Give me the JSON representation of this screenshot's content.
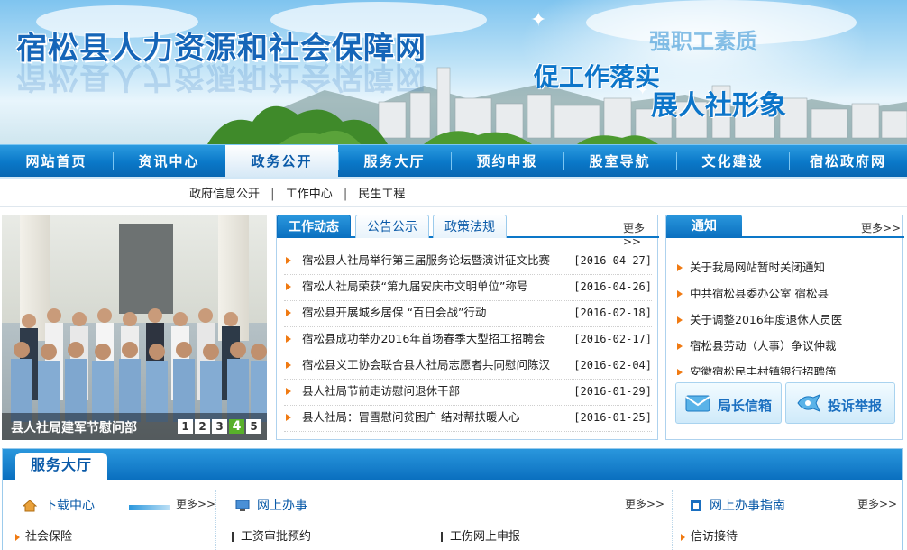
{
  "header": {
    "site_title": "宿松县人力资源和社会保障网",
    "slogan_top": "强职工素质",
    "slogan_1": "促工作落实",
    "slogan_2": "展人社形象"
  },
  "nav": {
    "items": [
      "网站首页",
      "资讯中心",
      "政务公开",
      "服务大厅",
      "预约申报",
      "股室导航",
      "文化建设",
      "宿松政府网"
    ],
    "active_index": 2
  },
  "subnav": {
    "items": [
      "政府信息公开",
      "工作中心",
      "民生工程"
    ],
    "separator": "|"
  },
  "slider": {
    "caption": "县人社局建军节慰问部",
    "pages": [
      "1",
      "2",
      "3",
      "4",
      "5"
    ],
    "active_page": "4"
  },
  "news": {
    "tabs": [
      "工作动态",
      "公告公示",
      "政策法规"
    ],
    "active_tab": 0,
    "more": "更多>>",
    "items": [
      {
        "title": "宿松县人社局举行第三届服务论坛暨演讲征文比赛",
        "date": "[2016-04-27]"
      },
      {
        "title": "宿松人社局荣获“第九届安庆市文明单位”称号",
        "date": "[2016-04-26]"
      },
      {
        "title": "宿松县开展城乡居保 “百日会战”行动",
        "date": "[2016-02-18]"
      },
      {
        "title": "宿松县成功举办2016年首场春季大型招工招聘会",
        "date": "[2016-02-17]"
      },
      {
        "title": "宿松县义工协会联合县人社局志愿者共同慰问陈汉",
        "date": "[2016-02-04]"
      },
      {
        "title": "县人社局节前走访慰问退休干部",
        "date": "[2016-01-29]"
      },
      {
        "title": "县人社局：冒雪慰问贫困户 结对帮扶暖人心",
        "date": "[2016-01-25]"
      }
    ]
  },
  "notice": {
    "title": "通知",
    "more": "更多>>",
    "items": [
      "关于我局网站暂时关闭通知",
      "中共宿松县委办公室 宿松县",
      "关于调整2016年度退休人员医",
      "宿松县劳动（人事）争议仲裁",
      "安徽宿松民丰村镇银行招聘简"
    ],
    "buttons": [
      "局长信箱",
      "投诉举报"
    ]
  },
  "hall": {
    "title": "服务大厅",
    "columns": [
      {
        "title": "下载中心",
        "more": "更多>>",
        "items": [
          "社会保险"
        ]
      },
      {
        "title": "网上办事",
        "more": "更多>>",
        "items": [
          "工资审批预约",
          "工伤网上申报"
        ]
      },
      {
        "title": "网上办事指南",
        "more": "更多>>",
        "items": [
          "信访接待"
        ]
      }
    ]
  },
  "colors": {
    "nav_blue": "#0a78c8",
    "title_blue": "#1565b8",
    "accent_orange": "#f07a12",
    "active_page_green": "#58b02a"
  }
}
